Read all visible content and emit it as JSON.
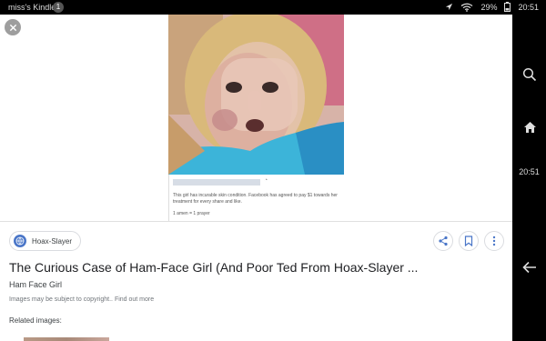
{
  "status_bar": {
    "device_name": "miss's Kindle",
    "notification_count": "1",
    "battery": "29%",
    "time": "20:51",
    "icons": [
      "location-icon",
      "wifi-icon",
      "battery-icon"
    ]
  },
  "nav_bar": {
    "icons": [
      "search-icon",
      "home-icon",
      "back-icon"
    ],
    "time": "20:51"
  },
  "viewer": {
    "close_icon": "close-icon",
    "post": {
      "caption": "This girl has incurable skin condition. Facebook has agreed to pay $1 towards her treatment for every share and like.",
      "meta": "1 amen = 1 prayer"
    },
    "source": {
      "name": "Hoax-Slayer",
      "icon": "globe-icon"
    },
    "actions": [
      "share-icon",
      "bookmark-icon",
      "more-vert-icon"
    ],
    "title": "The Curious Case of Ham-Face Girl (And Poor Ted From Hoax-Slayer ...",
    "subtitle": "Ham Face Girl",
    "copyright": "Images may be subject to copyright.. Find out more",
    "related_label": "Related images:"
  },
  "colors": {
    "accent": "#4a76c8",
    "text_primary": "#202124",
    "text_secondary": "#70757a"
  }
}
